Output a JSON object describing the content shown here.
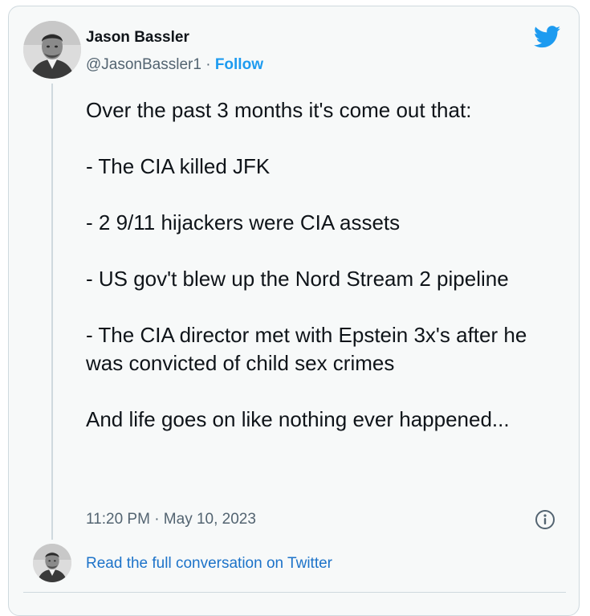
{
  "author": {
    "name": "Jason Bassler",
    "handle": "@JasonBassler1",
    "separator": " · ",
    "follow_label": "Follow"
  },
  "tweet": {
    "paragraphs": [
      "Over the past 3 months it's come out that:",
      "- The CIA killed JFK",
      "- 2 9/11 hijackers were CIA assets",
      "- US gov't blew up the Nord Stream 2 pipeline",
      "- The CIA director met with Epstein 3x's after he was convicted of child sex crimes",
      "And life goes on like nothing ever happened..."
    ],
    "timestamp": "11:20 PM · May 10, 2023"
  },
  "footer": {
    "read_full_label": "Read the full conversation on Twitter"
  },
  "icons": {
    "brand": "twitter-bird-icon",
    "info": "info-icon"
  },
  "colors": {
    "accent": "#1d9bf0",
    "link": "#1d73c9",
    "text": "#0f1419",
    "muted": "#536471",
    "card_bg": "#f7f9f9",
    "border": "#cfd9de"
  }
}
